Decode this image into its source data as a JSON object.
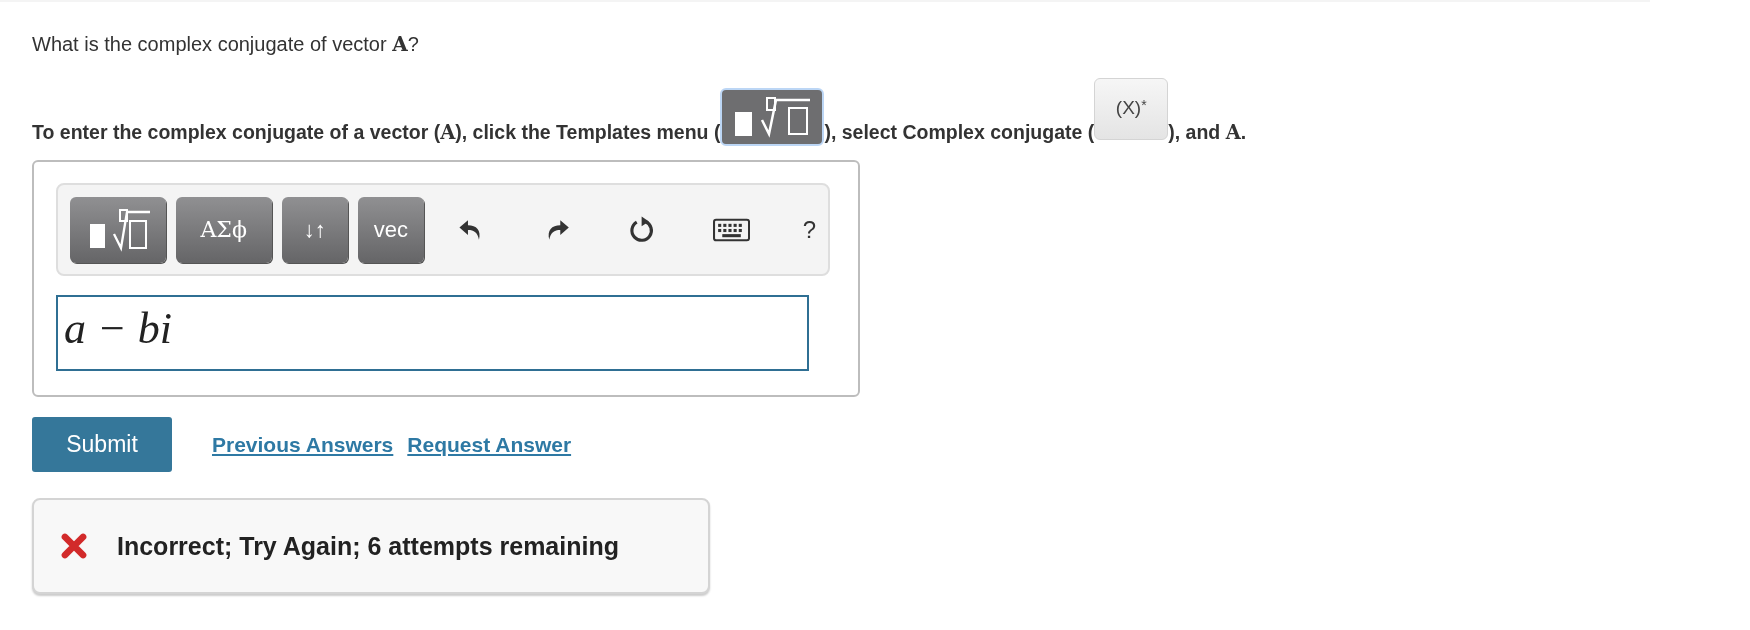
{
  "question": "What is the complex conjugate of vector **A**?",
  "instruction": [
    {
      "kind": "text",
      "text": "To enter the complex conjugate of a vector (**A**), click the Templates menu ("
    },
    {
      "kind": "templates"
    },
    {
      "kind": "text",
      "text": "), select Complex conjugate ("
    },
    {
      "kind": "conjugate",
      "text": "(X)",
      "sup": "*"
    },
    {
      "kind": "text",
      "text": "), and **A**."
    }
  ],
  "toolbar": [
    {
      "kind": "templates"
    },
    {
      "kind": "label",
      "text": "ΑΣϕ"
    },
    {
      "kind": "label",
      "text": "↓↑"
    },
    {
      "kind": "label",
      "text": "vec"
    },
    {
      "kind": "undo"
    },
    {
      "kind": "redo"
    },
    {
      "kind": "reset"
    },
    {
      "kind": "keyboard"
    },
    {
      "kind": "help",
      "text": "?"
    }
  ],
  "answer": {
    "value": "a − bi"
  },
  "submit": "Submit",
  "links": [
    "Previous Answers",
    "Request Answer"
  ],
  "feedback": {
    "kind": "incorrect",
    "text": "Incorrect; Try Again; 6 attempts remaining"
  }
}
